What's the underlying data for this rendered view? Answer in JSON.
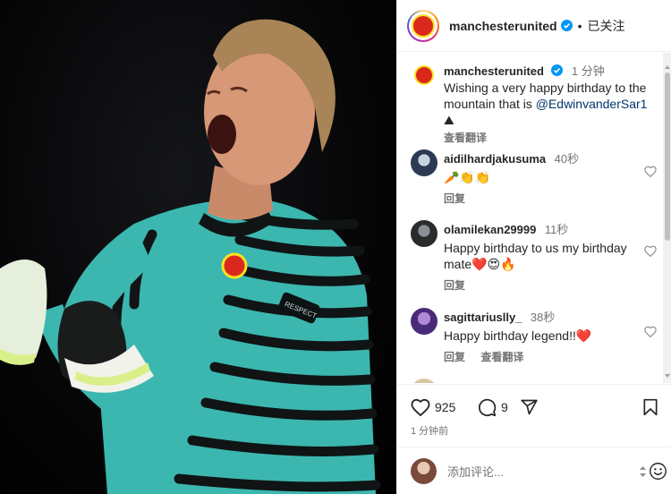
{
  "post": {
    "author": "manchesterunited",
    "follow_status": "已关注",
    "dot": "•",
    "media_text": {
      "kit_badge": "RESPECT"
    }
  },
  "comments": [
    {
      "user": "manchesterunited",
      "time": "1 分钟",
      "text_before": "Wishing a very happy birthday to the mountain that is ",
      "mention": "@EdwinvanderSar1",
      "emoji": "⛰",
      "translate": "查看翻译",
      "verified": true
    },
    {
      "user": "aidilhardjakusuma",
      "time": "40秒",
      "text": "🥕👏👏",
      "reply": "回复"
    },
    {
      "user": "olamilekan29999",
      "time": "11秒",
      "text": "Happy birthday to us my birthday mate❤️😍🔥",
      "reply": "回复"
    },
    {
      "user": "sagittariuslly_",
      "time": "38秒",
      "text": "Happy birthday legend!!❤️",
      "reply": "回复",
      "translate": "查看翻译"
    }
  ],
  "actions": {
    "likes": "925",
    "comments_count": "9",
    "posted_ago": "1 分钟前"
  },
  "composer": {
    "placeholder": "添加评论..."
  },
  "icons": {
    "like": "heart-icon",
    "comment": "comment-icon",
    "share": "share-icon",
    "save": "bookmark-icon",
    "emoji": "smiley-icon"
  },
  "colors": {
    "kit_teal": "#3bb7b0",
    "kit_black": "#101414",
    "glove_lime": "#d9f08a",
    "verified_blue": "#0095f6",
    "like_red": "#e0245e"
  }
}
